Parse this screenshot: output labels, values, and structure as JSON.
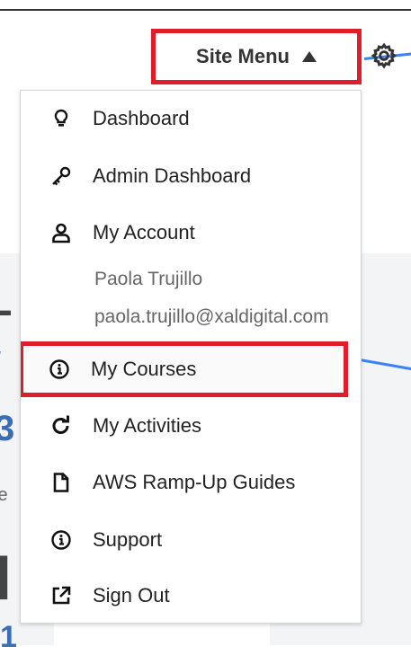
{
  "site_menu": {
    "label": "Site Menu",
    "expanded": true
  },
  "menu": {
    "items": [
      {
        "label": "Dashboard",
        "icon": "lightbulb-icon"
      },
      {
        "label": "Admin Dashboard",
        "icon": "key-icon"
      },
      {
        "label": "My Account",
        "icon": "user-icon"
      },
      {
        "label": "My Courses",
        "icon": "info-circle-icon"
      },
      {
        "label": "My Activities",
        "icon": "refresh-icon"
      },
      {
        "label": "AWS Ramp-Up Guides",
        "icon": "file-icon"
      },
      {
        "label": "Support",
        "icon": "info-circle-icon"
      },
      {
        "label": "Sign Out",
        "icon": "external-link-icon"
      }
    ],
    "account": {
      "name": "Paola Trujillo",
      "email": "paola.trujillo@xaldigital.com"
    }
  },
  "colors": {
    "highlight_border": "#e11d2b",
    "connector_line": "#3b82f6",
    "text": "#222222",
    "muted_text": "#666666"
  }
}
